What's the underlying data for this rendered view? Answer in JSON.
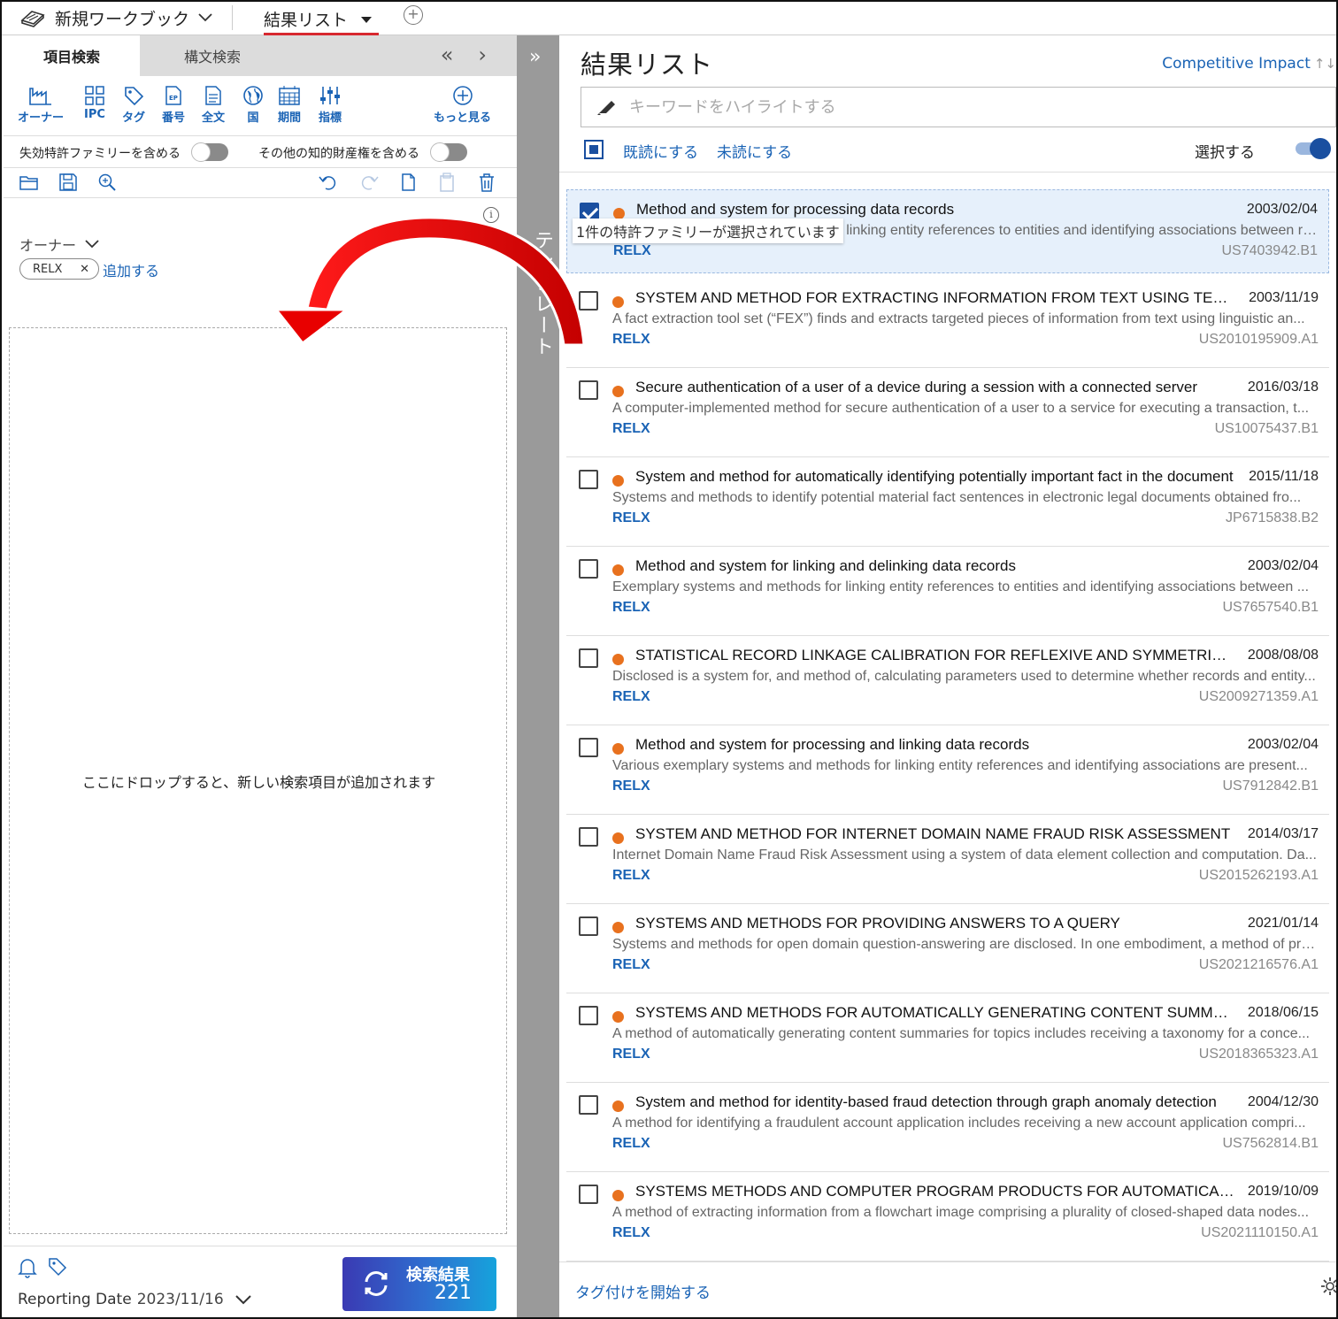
{
  "tabs": {
    "workbook": "新規ワークブック",
    "results": "結果リスト"
  },
  "left": {
    "search_tabs": [
      "項目検索",
      "構文検索"
    ],
    "fields": [
      {
        "label": "オーナー",
        "icon": "factory-icon"
      },
      {
        "label": "IPC",
        "icon": "grid-icon"
      },
      {
        "label": "タグ",
        "icon": "tag-icon"
      },
      {
        "label": "番号",
        "icon": "document-ep-icon"
      },
      {
        "label": "全文",
        "icon": "document-lines-icon"
      },
      {
        "label": "国",
        "icon": "globe-icon"
      },
      {
        "label": "期間",
        "icon": "calendar-icon"
      },
      {
        "label": "指標",
        "icon": "sliders-icon"
      },
      {
        "label": "もっと見る",
        "icon": "plus-circle-icon"
      }
    ],
    "toggle_expired": "失効特許ファミリーを含める",
    "toggle_other_ip": "その他の知的財産権を含める",
    "owner_label": "オーナー",
    "owner_chip": "RELX",
    "add_link": "追加する",
    "dropzone_msg": "ここにドロップすると、新しい検索項目が追加されます",
    "reporting_label": "Reporting Date",
    "reporting_date": "2023/11/16",
    "search_button_label": "検索結果",
    "search_button_count": "221"
  },
  "strip": {
    "vertical_text": "テンプレート"
  },
  "right": {
    "title": "結果リスト",
    "sort_label": "Competitive Impact",
    "highlight_placeholder": "キーワードをハイライトする",
    "mark_read": "既読にする",
    "mark_unread": "未読にする",
    "select_label": "選択する",
    "selected_tooltip": "1件の特許ファミリーが選択されています",
    "tag_start": "タグ付けを開始する",
    "accent_color": "#1a63b5",
    "dot_color": "#e8711e",
    "results": [
      {
        "title": "Method and system for processing data records",
        "date": "2003/02/04",
        "abstract": "Exemplary systems and methods for linking entity references to entities and identifying associations between records.",
        "owner": "RELX",
        "pubno": "US7403942.B1",
        "checked": true
      },
      {
        "title": "SYSTEM AND METHOD FOR EXTRACTING INFORMATION FROM TEXT USING TEXT A...",
        "date": "2003/11/19",
        "abstract": "A fact extraction tool set (“FEX”) finds and extracts targeted pieces of information from text using linguistic an...",
        "owner": "RELX",
        "pubno": "US2010195909.A1",
        "checked": false
      },
      {
        "title": "Secure authentication of a user of a device during a session with a connected server",
        "date": "2016/03/18",
        "abstract": "A computer-implemented method for secure authentication of a user to a service for executing a transaction, t...",
        "owner": "RELX",
        "pubno": "US10075437.B1",
        "checked": false
      },
      {
        "title": "System and method for automatically identifying potentially important fact in the document",
        "date": "2015/11/18",
        "abstract": "Systems and methods to identify potential material fact sentences in electronic legal documents obtained fro...",
        "owner": "RELX",
        "pubno": "JP6715838.B2",
        "checked": false
      },
      {
        "title": "Method and system for linking and delinking data records",
        "date": "2003/02/04",
        "abstract": "Exemplary systems and methods for linking entity references to entities and identifying associations between ...",
        "owner": "RELX",
        "pubno": "US7657540.B1",
        "checked": false
      },
      {
        "title": "STATISTICAL RECORD LINKAGE CALIBRATION FOR REFLEXIVE AND SYMMETRIC DIST...",
        "date": "2008/08/08",
        "abstract": "Disclosed is a system for, and method of, calculating parameters used to determine whether records and entity...",
        "owner": "RELX",
        "pubno": "US2009271359.A1",
        "checked": false
      },
      {
        "title": "Method and system for processing and linking data records",
        "date": "2003/02/04",
        "abstract": "Various exemplary systems and methods for linking entity references and identifying associations are present...",
        "owner": "RELX",
        "pubno": "US7912842.B1",
        "checked": false
      },
      {
        "title": "SYSTEM AND METHOD FOR INTERNET DOMAIN NAME FRAUD RISK ASSESSMENT",
        "date": "2014/03/17",
        "abstract": "Internet Domain Name Fraud Risk Assessment using a system of data element collection and computation. Da...",
        "owner": "RELX",
        "pubno": "US2015262193.A1",
        "checked": false
      },
      {
        "title": "SYSTEMS AND METHODS FOR PROVIDING ANSWERS TO A QUERY",
        "date": "2021/01/14",
        "abstract": "Systems and methods for open domain question-answering are disclosed. In one embodiment, a method of pro...",
        "owner": "RELX",
        "pubno": "US2021216576.A1",
        "checked": false
      },
      {
        "title": "SYSTEMS AND METHODS FOR AUTOMATICALLY GENERATING CONTENT SUMMARIES...",
        "date": "2018/06/15",
        "abstract": "A method of automatically generating content summaries for topics includes receiving a taxonomy for a conce...",
        "owner": "RELX",
        "pubno": "US2018365323.A1",
        "checked": false
      },
      {
        "title": "System and method for identity-based fraud detection through graph anomaly detection",
        "date": "2004/12/30",
        "abstract": "A method for identifying a fraudulent account application includes receiving a new account application compri...",
        "owner": "RELX",
        "pubno": "US7562814.B1",
        "checked": false
      },
      {
        "title": "SYSTEMS METHODS AND COMPUTER PROGRAM PRODUCTS FOR AUTOMATICALLY E...",
        "date": "2019/10/09",
        "abstract": "A method of extracting information from a flowchart image comprising a plurality of closed-shaped data nodes...",
        "owner": "RELX",
        "pubno": "US2021110150.A1",
        "checked": false
      }
    ]
  }
}
